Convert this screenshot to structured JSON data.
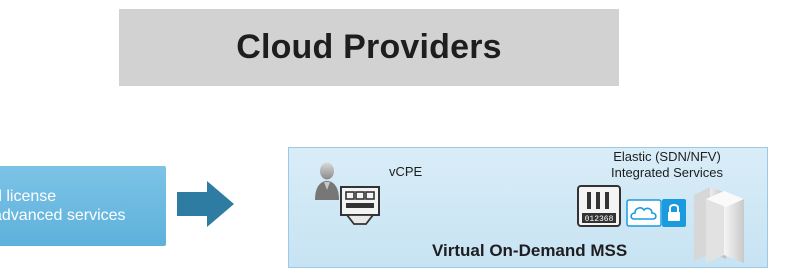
{
  "header": {
    "title": "Cloud Providers"
  },
  "license_box": {
    "line1": "d license",
    "line2": "advanced services"
  },
  "mss_panel": {
    "vcpe_label": "vCPE",
    "elastic_line1": "Elastic (SDN/NFV)",
    "elastic_line2": "Integrated Services",
    "title": "Virtual On-Demand MSS",
    "appliance_display": "012368"
  },
  "icons": {
    "arrow": "right-arrow-icon",
    "user": "user-icon",
    "vcpe_device": "vcpe-device-icon",
    "security_appliance": "firewall-appliance-icon",
    "cloud": "cloud-icon",
    "lock": "lock-icon",
    "servers": "server-rack-icon"
  },
  "colors": {
    "banner": "#d2d2d2",
    "license_box": "#6bbae2",
    "arrow": "#2f7ca3",
    "panel": "#d2e9f6",
    "panel_border": "#9cc9e3"
  }
}
